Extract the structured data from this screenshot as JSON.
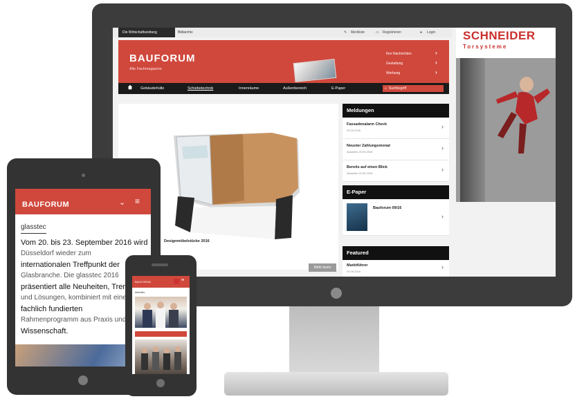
{
  "desktop": {
    "topbar": {
      "tab_active": "Die Wirtschaftszeitung",
      "tab_inactive": "Bildarchiv",
      "util_1": "Merkliste",
      "util_2": "Registrieren",
      "util_3": "Login"
    },
    "header": {
      "brand": "BAUFORUM",
      "subtitle": "Alle Fachmagazine",
      "links": [
        "Ihre Nachrichten",
        "Gestaltung",
        "Werbung"
      ]
    },
    "nav": {
      "items": [
        "Gebäudehülle",
        "Schiebetechnik",
        "Innenräume",
        "Außenbereich",
        "E-Paper"
      ],
      "search_placeholder": "Suchbegriff"
    },
    "hero": {
      "caption": "Designmöbelstücke 2016",
      "more_button": "Mehr lesen"
    },
    "sidebar": {
      "meldungen_title": "Meldungen",
      "meldungen": [
        {
          "title": "Fassadenalarm Check",
          "date": "20.09.2016"
        },
        {
          "title": "Neuster Zahlungsmonat",
          "date": "Aktuelles 20.09.2016"
        },
        {
          "title": "Bereits auf einen Blick",
          "date": "Aktuelles 20.09.2016"
        }
      ],
      "epaper_title": "E-Paper",
      "epaper_item": "Bauforum 09/16",
      "featured_title": "Featured",
      "featured_item": {
        "title": "Marktführer",
        "date": "20.09.2016"
      }
    },
    "ad": {
      "title": "SCHNEIDER",
      "subtitle": "Torsysteme"
    }
  },
  "tablet": {
    "brand": "BAUFORUM",
    "menu_icon": "chevron-down-icon",
    "lines": [
      "glasstec",
      "Vom 20. bis 23. September 2016 wird",
      "Düsseldorf wieder zum",
      "internationalen Treffpunkt der",
      "Glasbranche. Die glasstec 2016",
      "präsentiert alle Neuheiten, Trends",
      "und Lösungen, kombiniert mit einem",
      "fachlich fundierten",
      "Rahmenprogramm aus Praxis und",
      "Wissenschaft."
    ]
  },
  "phone": {
    "brand": "BAUFORUM",
    "line": "Aktuelles"
  },
  "colors": {
    "brand_red": "#d0483c",
    "device_frame": "#333333",
    "nav_dark": "#1a1a1a"
  }
}
